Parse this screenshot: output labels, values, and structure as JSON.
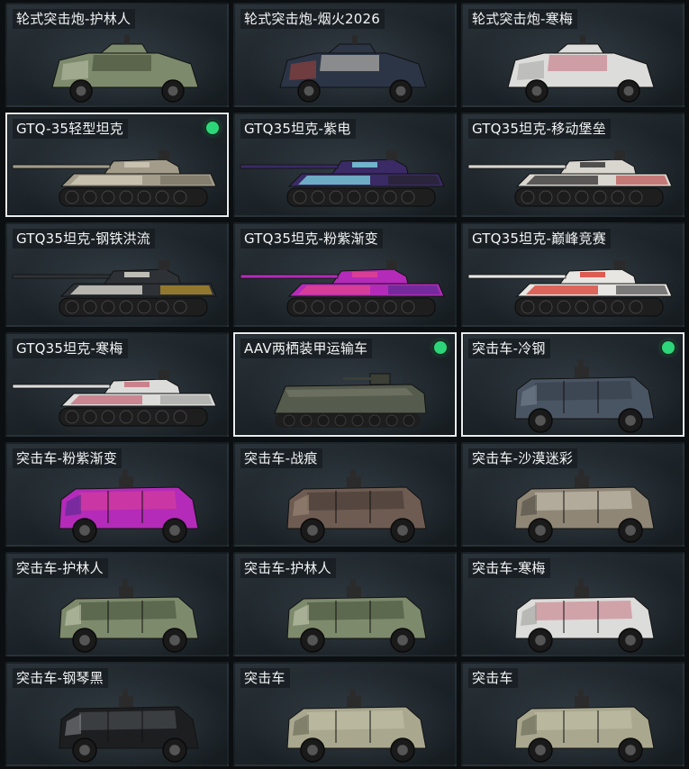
{
  "cards": [
    {
      "label": "轮式突击炮-护林人",
      "vehicle": "wheeled-assault-gun",
      "camo": "forest",
      "selected": false,
      "owned": false
    },
    {
      "label": "轮式突击炮-烟火2026",
      "vehicle": "wheeled-assault-gun",
      "camo": "firework",
      "selected": false,
      "owned": false
    },
    {
      "label": "轮式突击炮-寒梅",
      "vehicle": "wheeled-assault-gun",
      "camo": "plum",
      "selected": false,
      "owned": false
    },
    {
      "label": "GTQ-35轻型坦克",
      "vehicle": "light-tank",
      "camo": "sand",
      "selected": true,
      "owned": true
    },
    {
      "label": "GTQ35坦克-紫电",
      "vehicle": "light-tank",
      "camo": "purple-lightning",
      "selected": false,
      "owned": false
    },
    {
      "label": "GTQ35坦克-移动堡垒",
      "vehicle": "light-tank",
      "camo": "fortress",
      "selected": false,
      "owned": false
    },
    {
      "label": "GTQ35坦克-钢铁洪流",
      "vehicle": "light-tank",
      "camo": "steel",
      "selected": false,
      "owned": false
    },
    {
      "label": "GTQ35坦克-粉紫渐变",
      "vehicle": "light-tank",
      "camo": "gradient",
      "selected": false,
      "owned": false
    },
    {
      "label": "GTQ35坦克-巅峰竞赛",
      "vehicle": "light-tank",
      "camo": "race",
      "selected": false,
      "owned": false
    },
    {
      "label": "GTQ35坦克-寒梅",
      "vehicle": "light-tank",
      "camo": "plum",
      "selected": false,
      "owned": false
    },
    {
      "label": "AAV两栖装甲运输车",
      "vehicle": "amphibious-apc",
      "camo": "olive",
      "selected": true,
      "owned": true
    },
    {
      "label": "突击车-冷钢",
      "vehicle": "assault-vehicle",
      "camo": "cold-steel",
      "selected": true,
      "owned": true
    },
    {
      "label": "突击车-粉紫渐变",
      "vehicle": "assault-vehicle",
      "camo": "gradient",
      "selected": false,
      "owned": false
    },
    {
      "label": "突击车-战痕",
      "vehicle": "assault-vehicle",
      "camo": "battle-scar",
      "selected": false,
      "owned": false
    },
    {
      "label": "突击车-沙漠迷彩",
      "vehicle": "assault-vehicle",
      "camo": "desert",
      "selected": false,
      "owned": false
    },
    {
      "label": "突击车-护林人",
      "vehicle": "assault-vehicle",
      "camo": "forest",
      "selected": false,
      "owned": false
    },
    {
      "label": "突击车-护林人",
      "vehicle": "assault-vehicle",
      "camo": "forest",
      "selected": false,
      "owned": false
    },
    {
      "label": "突击车-寒梅",
      "vehicle": "assault-vehicle",
      "camo": "plum",
      "selected": false,
      "owned": false
    },
    {
      "label": "突击车-钢琴黑",
      "vehicle": "assault-vehicle",
      "camo": "piano-black",
      "selected": false,
      "owned": false
    },
    {
      "label": "突击车",
      "vehicle": "assault-vehicle",
      "camo": "default",
      "selected": false,
      "owned": false
    },
    {
      "label": "突击车",
      "vehicle": "assault-vehicle",
      "camo": "default",
      "selected": false,
      "owned": false
    }
  ],
  "camo_colors": {
    "forest": {
      "body": "#7e8a6c",
      "accent": "#3c4732",
      "detail": "#c9cdb6"
    },
    "firework": {
      "body": "#2c3546",
      "accent": "#d8d2c6",
      "detail": "#c2453a"
    },
    "plum": {
      "body": "#dcdcda",
      "accent": "#c46a78",
      "detail": "#9a9a98"
    },
    "sand": {
      "body": "#a39c8a",
      "accent": "#d3ccb9",
      "detail": "#6f6a5d"
    },
    "purple-lightning": {
      "body": "#3a2a66",
      "accent": "#7fd8e6",
      "detail": "#222"
    },
    "fortress": {
      "body": "#d9d6d0",
      "accent": "#2d2d2d",
      "detail": "#b83a3a"
    },
    "steel": {
      "body": "#2e3236",
      "accent": "#e4e1d8",
      "detail": "#d4a62a"
    },
    "gradient": {
      "body": "#b32bb8",
      "accent": "#e2448f",
      "detail": "#4a2a8a"
    },
    "race": {
      "body": "#e8e6e2",
      "accent": "#d83a2e",
      "detail": "#2f3133"
    },
    "olive": {
      "body": "#555b4d",
      "accent": "#3b3f36",
      "detail": "#7b7f70"
    },
    "cold-steel": {
      "body": "#4a5563",
      "accent": "#2f3843",
      "detail": "#7a8594"
    },
    "battle-scar": {
      "body": "#6e5c52",
      "accent": "#3c322c",
      "detail": "#a38e7e"
    },
    "desert": {
      "body": "#8f8676",
      "accent": "#d6cfbf",
      "detail": "#4b463d"
    },
    "piano-black": {
      "body": "#1d1e20",
      "accent": "#5a5d62",
      "detail": "#8a8d92"
    },
    "default": {
      "body": "#a9a88f",
      "accent": "#c9c8b0",
      "detail": "#5f5e4e"
    }
  }
}
